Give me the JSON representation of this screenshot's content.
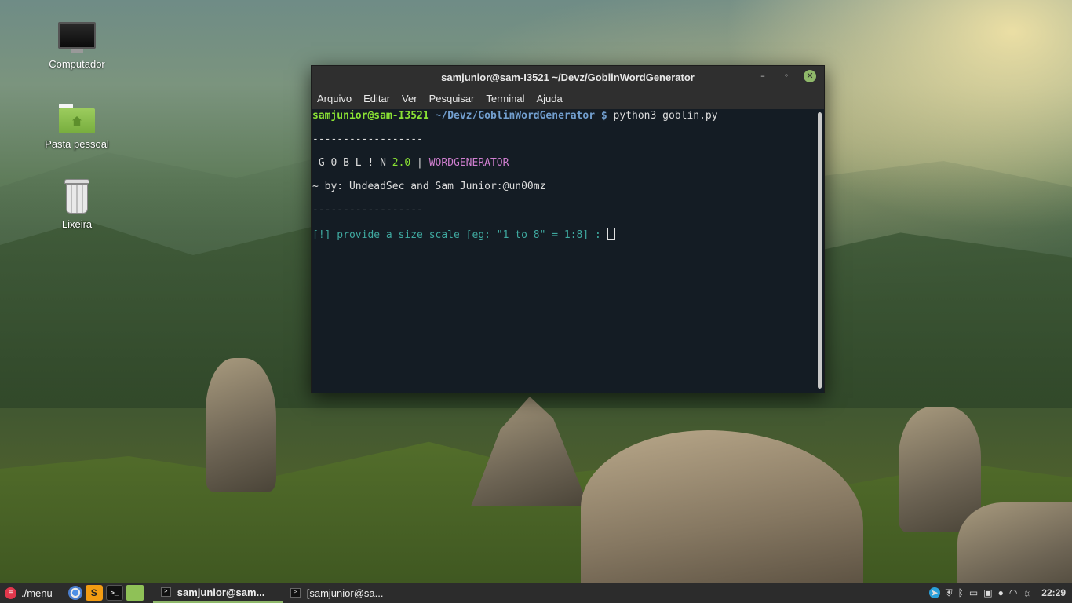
{
  "desktop": {
    "icons": [
      {
        "label": "Computador",
        "icon": "monitor-icon"
      },
      {
        "label": "Pasta pessoal",
        "icon": "home-folder-icon"
      },
      {
        "label": "Lixeira",
        "icon": "trash-icon"
      }
    ]
  },
  "window": {
    "title": "samjunior@sam-I3521 ~/Devz/GoblinWordGenerator",
    "controls": {
      "minimize": "–",
      "maximize": "◦",
      "close": "✕"
    },
    "menu": [
      "Arquivo",
      "Editar",
      "Ver",
      "Pesquisar",
      "Terminal",
      "Ajuda"
    ]
  },
  "terminal": {
    "prompt_user": "samjunior@sam-I3521",
    "prompt_path": "~/Devz/GoblinWordGenerator",
    "prompt_symbol": "$",
    "command": "python3 goblin.py",
    "divider1": "------------------",
    "banner_letters": " G 0 B L ! N ",
    "banner_version": "2.0",
    "banner_sep": " | ",
    "banner_name": "WORDGENERATOR",
    "byline": "~ by: UndeadSec and Sam Junior:@un00mz",
    "divider2": "------------------",
    "input_prompt": "[!] provide a size scale [eg: \"1 to 8\" = 1:8] : "
  },
  "taskbar": {
    "menu_label": "./menu",
    "launchers": [
      "chrome-icon",
      "sublime-icon",
      "terminal-icon",
      "files-icon"
    ],
    "sublime_letter": "S",
    "terminal_glyph": ">_",
    "tasks": [
      {
        "label": "samjunior@sam...",
        "active": true
      },
      {
        "label": "[samjunior@sa...",
        "active": false
      }
    ],
    "tray_icons": [
      "telegram-icon",
      "shield-icon",
      "bluetooth-icon",
      "display-icon",
      "workspace-icon",
      "user-icon",
      "wifi-icon",
      "brightness-icon"
    ],
    "clock": "22:29"
  },
  "colors": {
    "prompt_green": "#8ae234",
    "prompt_blue": "#729fcf",
    "accent_green": "#8fb86a",
    "terminal_bg": "#141c24"
  }
}
